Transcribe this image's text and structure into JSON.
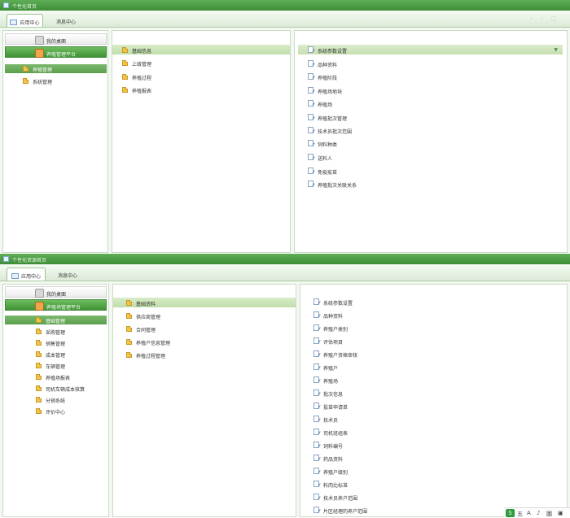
{
  "top_window": {
    "title": "个性化首页",
    "tabs": [
      "应用中心",
      "消息中心"
    ],
    "sidebar": {
      "buttons": [
        "我的桌面",
        "养殖管理平台"
      ],
      "items": [
        "养殖管理",
        "系统管理"
      ],
      "selected_index": 0
    },
    "middle": {
      "items": [
        "基础信息",
        "上级管理",
        "养殖过程",
        "养殖报表"
      ],
      "selected_index": 0
    },
    "right": {
      "items": [
        "系统参数设置",
        "品种资料",
        "养殖阶段",
        "养殖场地块",
        "养殖场",
        "养殖批次管理",
        "技术员批次范围",
        "饲料种类",
        "送料人",
        "免疫疫苗",
        "养殖批次关联关系"
      ],
      "selected_index": 0,
      "caret": "▼"
    },
    "window_controls": [
      "‹",
      "›",
      "▢"
    ]
  },
  "bottom_window": {
    "title": "个性化资源首页",
    "tabs": [
      "应用中心",
      "消息中心"
    ],
    "sidebar": {
      "buttons": [
        "我的桌面",
        "养殖场管理平台"
      ],
      "items": [
        "基础管理",
        "采购管理",
        "销售管理",
        "成本管理",
        "车辆管理",
        "养殖场报表",
        "司机车辆成本核算",
        "分销系统",
        "评价中心"
      ],
      "selected_index": 0
    },
    "middle": {
      "items": [
        "基础资料",
        "供应商管理",
        "合同管理",
        "养殖户信息管理",
        "养殖过程管理"
      ],
      "selected_index": 0
    },
    "right": {
      "items": [
        "系统参数设置",
        "品种资料",
        "养殖户类别",
        "评估项目",
        "养殖户资格审核",
        "养殖户",
        "养殖场",
        "批次信息",
        "投苗申请单",
        "技术员",
        "司机班组表",
        "饲料编号",
        "药品资料",
        "养殖户级别",
        "料肉比标准",
        "技术员养户范围",
        "片区经理的养户范围"
      ],
      "selected_index": -1
    }
  },
  "taskbar": {
    "logo_char": "S",
    "items": [
      "五",
      "A",
      "♪",
      "圖",
      "▣"
    ]
  },
  "colors": {
    "title_green": "#3c8d36",
    "select_green": "#5c9e4e",
    "light_select": "#c6e0b1",
    "border": "#c9dbc4"
  }
}
